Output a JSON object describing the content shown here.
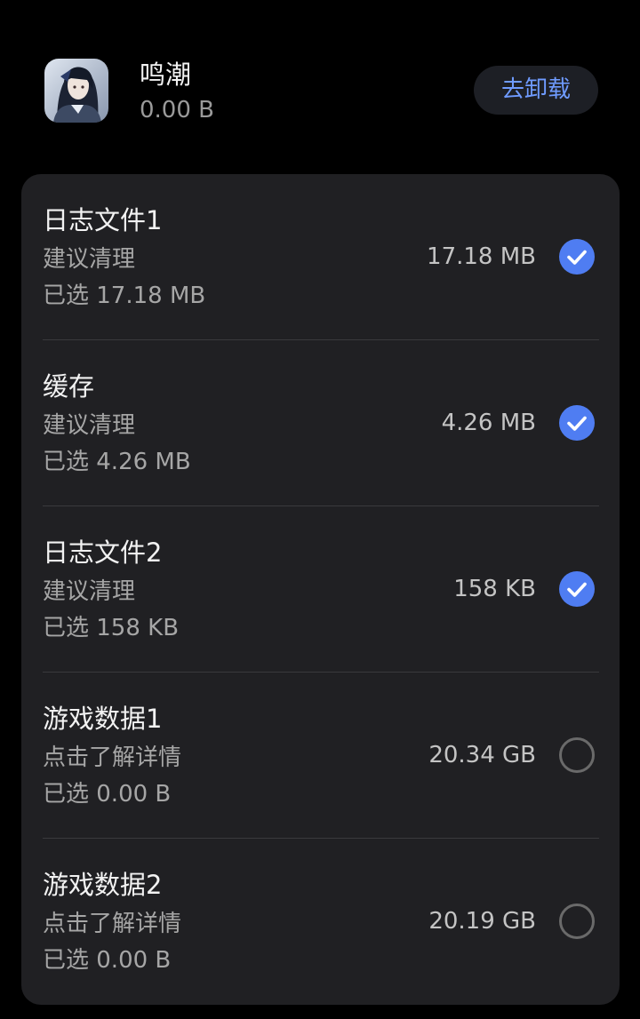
{
  "app": {
    "name": "鸣潮",
    "size": "0.00 B",
    "uninstall_label": "去卸载"
  },
  "items": [
    {
      "title": "日志文件1",
      "subtitle": "建议清理",
      "selected": "已选 17.18 MB",
      "size": "17.18 MB",
      "checked": true
    },
    {
      "title": "缓存",
      "subtitle": "建议清理",
      "selected": "已选 4.26 MB",
      "size": "4.26 MB",
      "checked": true
    },
    {
      "title": "日志文件2",
      "subtitle": "建议清理",
      "selected": "已选 158 KB",
      "size": "158 KB",
      "checked": true
    },
    {
      "title": "游戏数据1",
      "subtitle": "点击了解详情",
      "selected": "已选 0.00 B",
      "size": "20.34 GB",
      "checked": false
    },
    {
      "title": "游戏数据2",
      "subtitle": "点击了解详情",
      "selected": "已选 0.00 B",
      "size": "20.19 GB",
      "checked": false
    }
  ],
  "colors": {
    "accent": "#4f7df2",
    "button_text": "#6f9bff",
    "card_background": "#202023",
    "page_background": "#000000"
  }
}
